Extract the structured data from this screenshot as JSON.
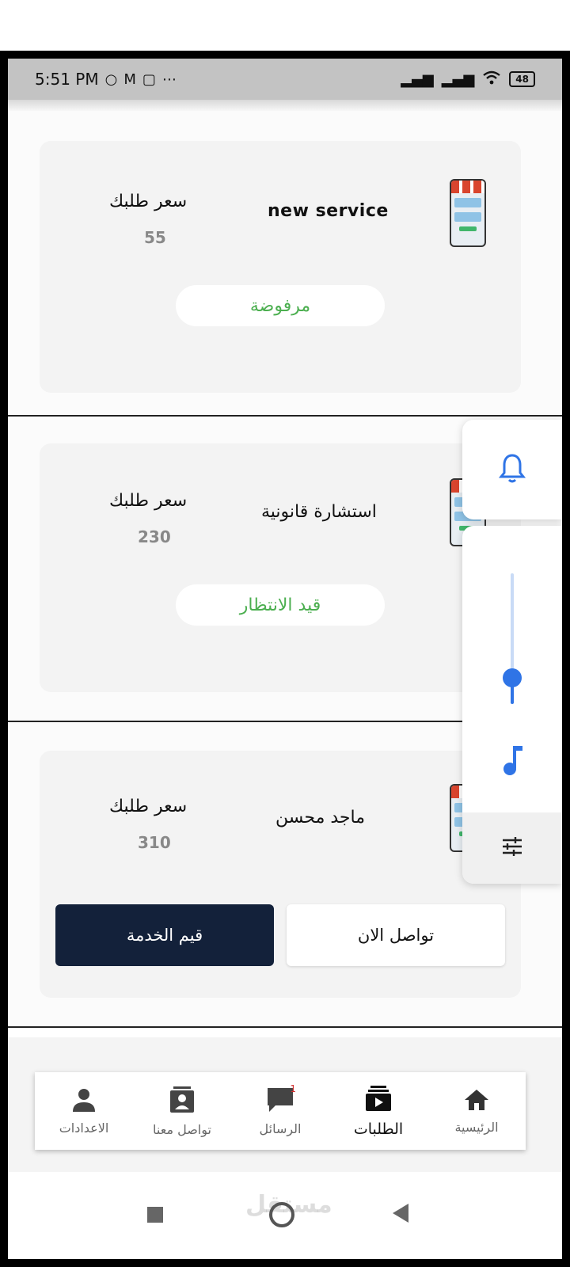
{
  "status_bar": {
    "time": "5:51 PM",
    "battery": "48",
    "icons": [
      "whatsapp-icon",
      "gmail-icon",
      "instagram-icon",
      "more-icon",
      "signal-icon",
      "signal-icon",
      "wifi-icon",
      "battery-icon"
    ]
  },
  "orders": [
    {
      "title": "new service",
      "price_label": "سعر طلبك",
      "price": "55",
      "status": "مرفوضة"
    },
    {
      "title": "استشارة قانونية",
      "price_label": "سعر طلبك",
      "price": "230",
      "status": "قيد الانتظار"
    },
    {
      "title": "ماجد محسن",
      "price_label": "سعر طلبك",
      "price": "310",
      "actions": {
        "rate": "قيم الخدمة",
        "contact": "تواصل الان"
      }
    }
  ],
  "volume_panel": {
    "level": 0.2,
    "accent": "#2f74e6"
  },
  "bottom_nav": {
    "items": [
      {
        "label": "الرئيسية",
        "icon": "home-icon"
      },
      {
        "label": "الطلبات",
        "icon": "orders-icon",
        "active": true
      },
      {
        "label": "الرسائل",
        "icon": "chat-icon",
        "badge": "1"
      },
      {
        "label": "تواصل معنا",
        "icon": "contact-icon"
      },
      {
        "label": "الاعدادات",
        "icon": "person-icon"
      }
    ]
  },
  "system_nav": {
    "watermark": "مستقل"
  },
  "colors": {
    "status_green": "#4caf50",
    "primary_dark": "#13213a"
  }
}
